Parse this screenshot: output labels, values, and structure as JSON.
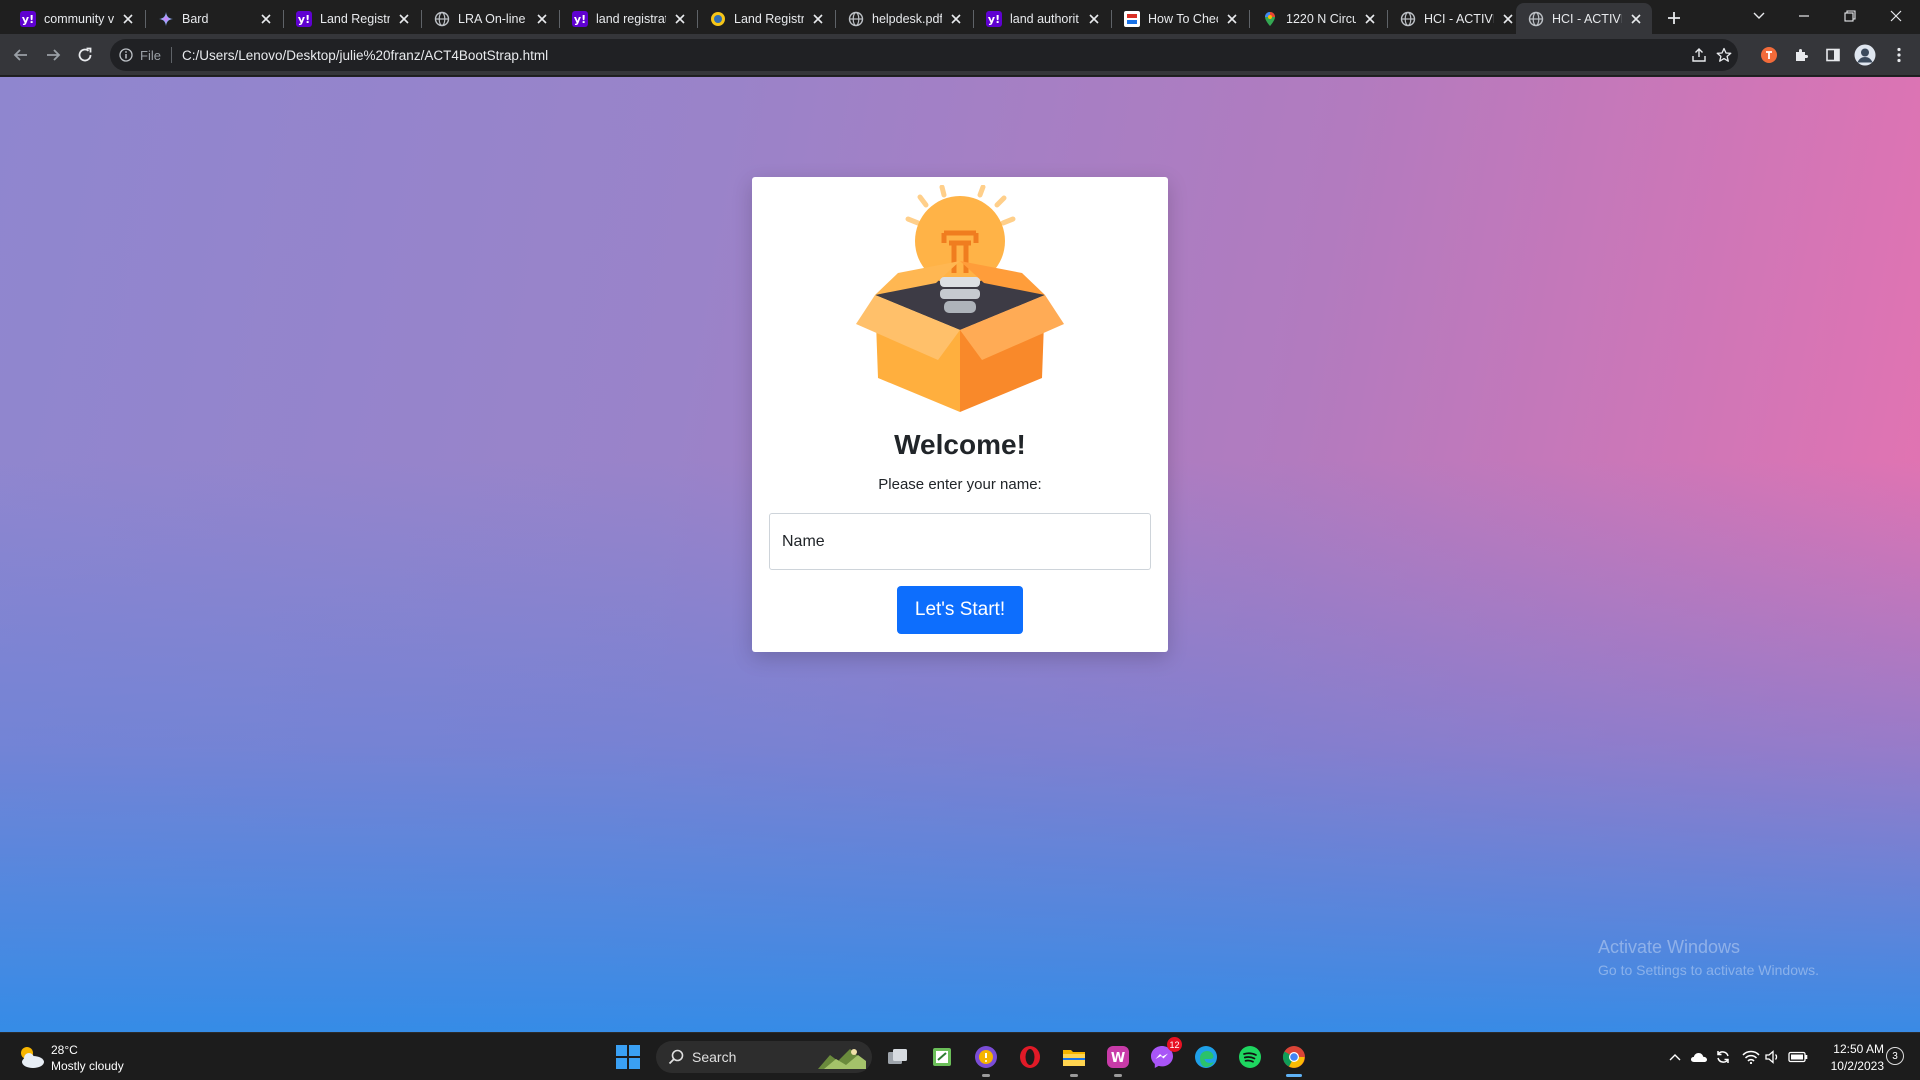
{
  "tabs": [
    {
      "title": "community v",
      "icon": "yahoo-icon"
    },
    {
      "title": "Bard",
      "icon": "bard-icon"
    },
    {
      "title": "Land Registr",
      "icon": "yahoo-icon"
    },
    {
      "title": "LRA On-line",
      "icon": "globe-icon"
    },
    {
      "title": "land registrat",
      "icon": "yahoo-icon"
    },
    {
      "title": "Land Registr",
      "icon": "site-icon"
    },
    {
      "title": "helpdesk.pdf",
      "icon": "globe-icon"
    },
    {
      "title": "land authorit",
      "icon": "yahoo-icon"
    },
    {
      "title": "How To Chec",
      "icon": "site-icon"
    },
    {
      "title": "1220 N Circu",
      "icon": "maps-icon"
    },
    {
      "title": "HCI - ACTIVI",
      "icon": "globe-icon"
    },
    {
      "title": "HCI - ACTIVI",
      "icon": "globe-icon",
      "active": true
    }
  ],
  "address_bar": {
    "scheme_label": "File",
    "url": "C:/Users/Lenovo/Desktop/julie%20franz/ACT4BootStrap.html"
  },
  "page": {
    "heading": "Welcome!",
    "prompt": "Please enter your name:",
    "name_placeholder": "Name",
    "start_button": "Let's Start!"
  },
  "watermark": {
    "line1": "Activate Windows",
    "line2": "Go to Settings to activate Windows."
  },
  "taskbar": {
    "weather_temp": "28°C",
    "weather_condition": "Mostly cloudy",
    "search_label": "Search",
    "messenger_badge": "12",
    "time": "12:50 AM",
    "date": "10/2/2023",
    "notification_count": "3"
  },
  "colors": {
    "primary_button": "#0d6efd",
    "gradient_pink": "#e872b0",
    "gradient_blue": "#308ce8",
    "gradient_purple": "#8f86cf"
  }
}
